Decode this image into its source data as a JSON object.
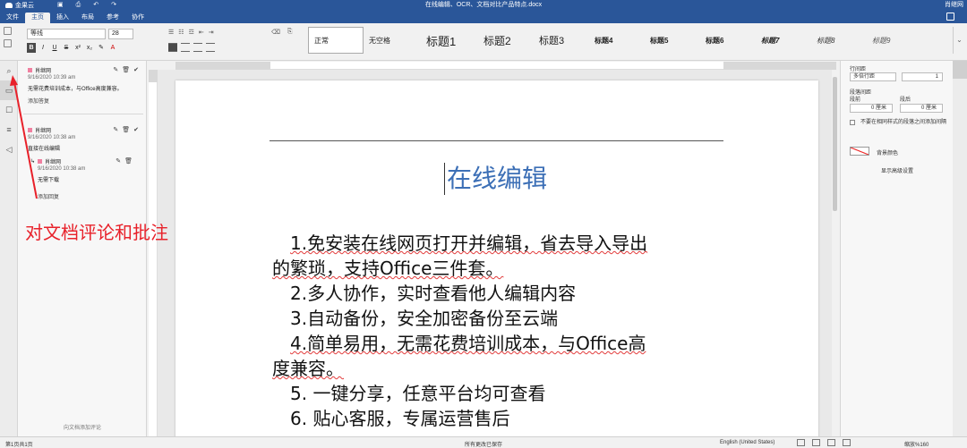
{
  "app": {
    "logo_text": "金果云",
    "document_title": "在线编辑、OCR、文档对比产品特点.docx",
    "user": "肖继网"
  },
  "menu": {
    "items": [
      "文件",
      "主页",
      "插入",
      "布局",
      "参考",
      "协作"
    ],
    "active": "主页"
  },
  "ribbon": {
    "font_name": "等线",
    "font_size": "28",
    "styles": [
      "正常",
      "无空格",
      "标题1",
      "标题2",
      "标题3",
      "标题4",
      "标题5",
      "标题6",
      "标题7",
      "标题8",
      "标题9"
    ]
  },
  "comments": [
    {
      "author": "肖继网",
      "time": "9/16/2020 10:39 am",
      "text": "无需花费培训成本，与Office高度兼容。",
      "link": "添加答复"
    },
    {
      "author": "肖继网",
      "time": "9/16/2020 10:38 am",
      "text": "直接在线编辑",
      "reply": {
        "author": "肖继网",
        "time": "9/16/2020 10:38 am",
        "text": "无需下载"
      },
      "link": "添加回复"
    }
  ],
  "comment_panel_footer": "向文档添加评论",
  "annotation": "对文档评论和批注",
  "document": {
    "heading": "在线编辑",
    "lines": [
      "1.免安装在线网页打开并编辑，省去导入导出",
      "的繁琐，支持Office三件套。",
      "2.多人协作，实时查看他人编辑内容",
      "3.自动备份，安全加密备份至云端",
      "4.简单易用，无需花费培训成本，与Office高",
      "度兼容。",
      "5. 一键分享，任意平台均可查看",
      "6. 贴心客服，专属运营售后"
    ]
  },
  "right_panel": {
    "line_spacing_label": "行间距",
    "line_spacing_value": "多倍行距",
    "line_spacing_num": "1",
    "para_spacing_label": "段落间距",
    "before_label": "段前",
    "after_label": "段后",
    "before_value": "0 厘米",
    "after_value": "0 厘米",
    "no_space_label": "不要在相同样式的段落之间添加间隔",
    "bg_color_label": "背景颜色",
    "advanced_label": "显示高级设置"
  },
  "status": {
    "page": "第1页共1页",
    "save_state": "所有更改已保存",
    "language": "English (United States)",
    "zoom": "缩放%160"
  },
  "colors": {
    "brand": "#2a5699",
    "heading": "#3c6fb6",
    "annotation": "#e8212a",
    "comment_swatch": "#f080a0"
  }
}
